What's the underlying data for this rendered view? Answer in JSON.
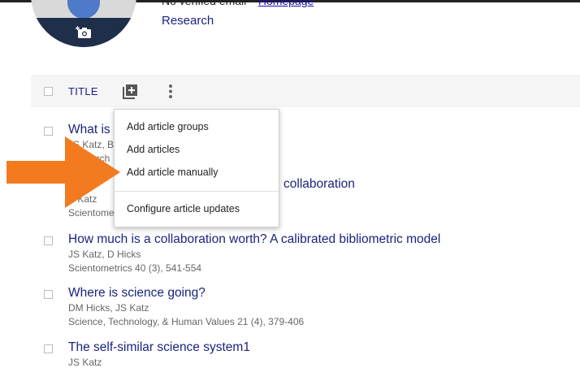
{
  "profile": {
    "email_text": "No verified email -",
    "homepage_label": "Homepage",
    "interest": "Research"
  },
  "table": {
    "title_column": "TITLE"
  },
  "menu": {
    "items": [
      "Add article groups",
      "Add articles",
      "Add article manually",
      "Configure article updates"
    ]
  },
  "articles": [
    {
      "title": "What is",
      "authors": "JS Katz, B",
      "venue": "Research"
    },
    {
      "title": "collaboration",
      "authors": "S Katz",
      "venue": "Scientome"
    },
    {
      "title": "How much is a collaboration worth? A calibrated bibliometric model",
      "authors": "JS Katz, D Hicks",
      "venue": "Scientometrics 40 (3), 541-554"
    },
    {
      "title": "Where is science going?",
      "authors": "DM Hicks, JS Katz",
      "venue": "Science, Technology, & Human Values 21 (4), 379-406"
    },
    {
      "title": "The self-similar science system1",
      "authors": "JS Katz",
      "venue": ""
    }
  ],
  "colors": {
    "arrow": "#f47a20",
    "link": "#1a237e",
    "header_bg": "#f5f5f5"
  },
  "icons": {
    "camera": "add-photo-icon",
    "add": "add-box-icon",
    "more": "more-vert-icon",
    "arrow": "arrow-right-icon"
  }
}
